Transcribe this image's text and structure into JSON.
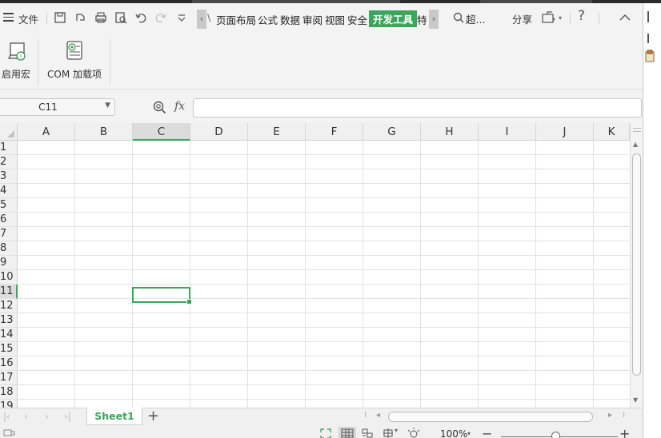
{
  "menubar": {
    "file_label": "文件",
    "tabs": [
      {
        "label": "页面布局"
      },
      {
        "label": "公式"
      },
      {
        "label": "数据"
      },
      {
        "label": "审阅"
      },
      {
        "label": "视图"
      },
      {
        "label": "安全"
      },
      {
        "label": "开发工具"
      },
      {
        "label": "特"
      }
    ],
    "tab_scroll_left": "‹",
    "tab_scroll_right": "›",
    "search_label": "超...",
    "share_label": "分享",
    "help_label": "?"
  },
  "ribbon": {
    "macro_label": "启用宏",
    "com_label": "COM 加载项"
  },
  "formula_bar": {
    "name_box_value": "C11",
    "fx_label": "fx",
    "formula_value": ""
  },
  "grid": {
    "columns": [
      "A",
      "B",
      "C",
      "D",
      "E",
      "F",
      "G",
      "H",
      "I",
      "J",
      "K"
    ],
    "rows": [
      "1",
      "2",
      "3",
      "4",
      "5",
      "6",
      "7",
      "8",
      "9",
      "10",
      "11",
      "12",
      "13",
      "14",
      "15",
      "16",
      "17",
      "18",
      "19"
    ],
    "selected_column": "C",
    "selected_row": "11"
  },
  "sheets": {
    "tabs": [
      {
        "label": "Sheet1"
      }
    ],
    "add_label": "+"
  },
  "status": {
    "zoom_label": "100%",
    "zoom_level_percent": 100
  },
  "colors": {
    "accent": "#3ba55c",
    "menu_bg": "#f3f3f3",
    "grid_line": "#e2e2e2"
  }
}
